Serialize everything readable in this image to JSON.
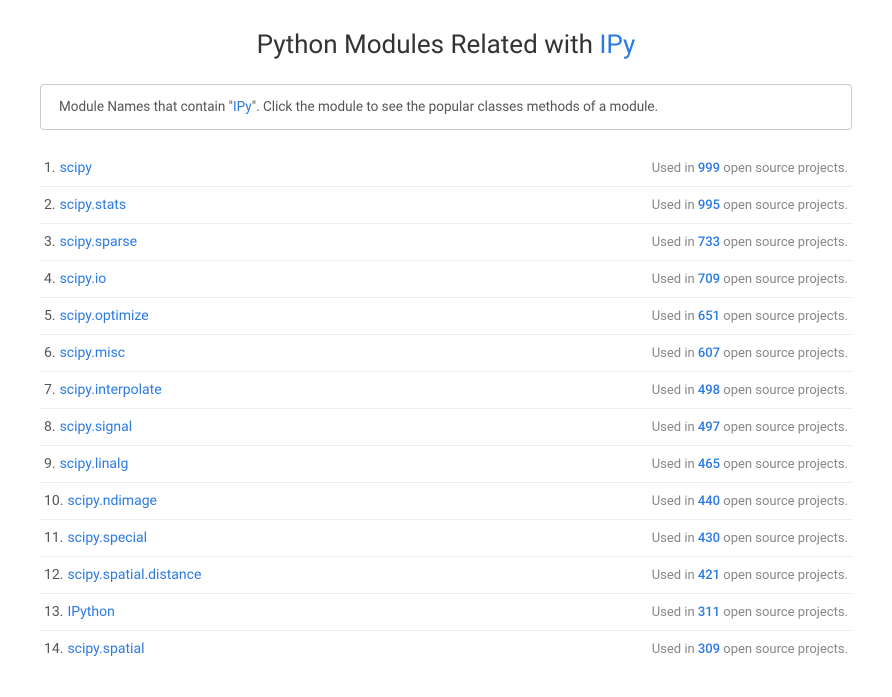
{
  "page": {
    "title_prefix": "Python Modules Related with ",
    "title_highlight": "IPy",
    "info_text_prefix": "Module Names that contain \"",
    "info_text_highlight": "IPy",
    "info_text_suffix": "\". Click the module to see the popular classes methods of a module."
  },
  "modules": [
    {
      "rank": "1",
      "name": "scipy",
      "count": "999"
    },
    {
      "rank": "2",
      "name": "scipy.stats",
      "count": "995"
    },
    {
      "rank": "3",
      "name": "scipy.sparse",
      "count": "733"
    },
    {
      "rank": "4",
      "name": "scipy.io",
      "count": "709"
    },
    {
      "rank": "5",
      "name": "scipy.optimize",
      "count": "651"
    },
    {
      "rank": "6",
      "name": "scipy.misc",
      "count": "607"
    },
    {
      "rank": "7",
      "name": "scipy.interpolate",
      "count": "498"
    },
    {
      "rank": "8",
      "name": "scipy.signal",
      "count": "497"
    },
    {
      "rank": "9",
      "name": "scipy.linalg",
      "count": "465"
    },
    {
      "rank": "10",
      "name": "scipy.ndimage",
      "count": "440"
    },
    {
      "rank": "11",
      "name": "scipy.special",
      "count": "430"
    },
    {
      "rank": "12",
      "name": "scipy.spatial.distance",
      "count": "421"
    },
    {
      "rank": "13",
      "name": "IPython",
      "count": "311"
    },
    {
      "rank": "14",
      "name": "scipy.spatial",
      "count": "309"
    }
  ],
  "labels": {
    "used_in": "Used in",
    "open_source": "open source projects."
  }
}
